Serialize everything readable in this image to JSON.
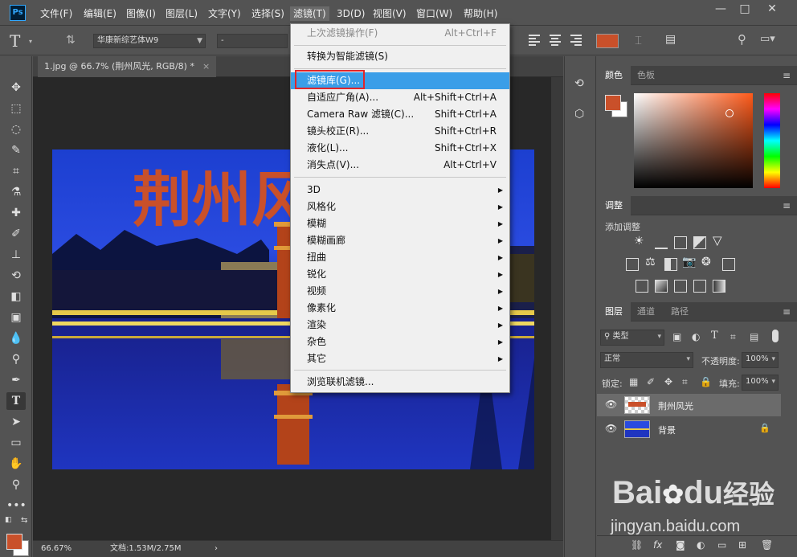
{
  "app": {
    "logo": "Ps"
  },
  "menubar": {
    "items": [
      "文件(F)",
      "编辑(E)",
      "图像(I)",
      "图层(L)",
      "文字(Y)",
      "选择(S)",
      "滤镜(T)",
      "3D(D)",
      "视图(V)",
      "窗口(W)",
      "帮助(H)"
    ]
  },
  "window_controls": {
    "minimize": "—",
    "maximize": "□",
    "close": "✕"
  },
  "options_bar": {
    "tool_icon": "T",
    "font_family": "华康新综艺体W9",
    "font_style": "-",
    "text_color": "#c9502a"
  },
  "document": {
    "tab_label": "1.jpg @ 66.7% (荆州风光, RGB/8) *",
    "close": "×",
    "image_text": "荆州风光"
  },
  "statusbar": {
    "zoom": "66.67%",
    "doc_info": "文档:1.53M/2.75M",
    "arrow": "›"
  },
  "color_panel": {
    "tabs": [
      "颜色",
      "色板"
    ],
    "foreground": "#c9502a",
    "background": "#ffffff"
  },
  "adjustments_panel": {
    "tab": "调整",
    "label": "添加调整"
  },
  "layers_panel": {
    "tabs": [
      "图层",
      "通道",
      "路径"
    ],
    "filter_type": "类型",
    "blend_mode": "正常",
    "opacity_label": "不透明度:",
    "opacity_value": "100%",
    "lock_label": "锁定:",
    "fill_label": "填充:",
    "fill_value": "100%",
    "layers": [
      {
        "name": "荆州风光",
        "selected": true
      },
      {
        "name": "背景",
        "locked": true
      }
    ],
    "footer_icons": [
      "link-icon",
      "fx-icon",
      "mask-icon",
      "adjustment-icon",
      "group-icon",
      "new-layer-icon",
      "trash-icon"
    ],
    "fx_label": "fx"
  },
  "filter_menu": {
    "items": [
      {
        "label": "上次滤镜操作(F)",
        "shortcut": "Alt+Ctrl+F",
        "disabled": true
      },
      {
        "label": "转换为智能滤镜(S)"
      },
      {
        "label": "滤镜库(G)...",
        "highlighted": true
      },
      {
        "label": "自适应广角(A)...",
        "shortcut": "Alt+Shift+Ctrl+A"
      },
      {
        "label": "Camera Raw 滤镜(C)...",
        "shortcut": "Shift+Ctrl+A"
      },
      {
        "label": "镜头校正(R)...",
        "shortcut": "Shift+Ctrl+R"
      },
      {
        "label": "液化(L)...",
        "shortcut": "Shift+Ctrl+X"
      },
      {
        "label": "消失点(V)...",
        "shortcut": "Alt+Ctrl+V"
      },
      {
        "label": "3D",
        "submenu": true
      },
      {
        "label": "风格化",
        "submenu": true
      },
      {
        "label": "模糊",
        "submenu": true
      },
      {
        "label": "模糊画廊",
        "submenu": true
      },
      {
        "label": "扭曲",
        "submenu": true
      },
      {
        "label": "锐化",
        "submenu": true
      },
      {
        "label": "视频",
        "submenu": true
      },
      {
        "label": "像素化",
        "submenu": true
      },
      {
        "label": "渲染",
        "submenu": true
      },
      {
        "label": "杂色",
        "submenu": true
      },
      {
        "label": "其它",
        "submenu": true
      },
      {
        "label": "浏览联机滤镜..."
      }
    ],
    "submenu_arrow": "▶"
  },
  "watermark": {
    "brand": "Bai",
    "brand2": "du",
    "brand3": "经验",
    "url": "jingyan.baidu.com"
  }
}
